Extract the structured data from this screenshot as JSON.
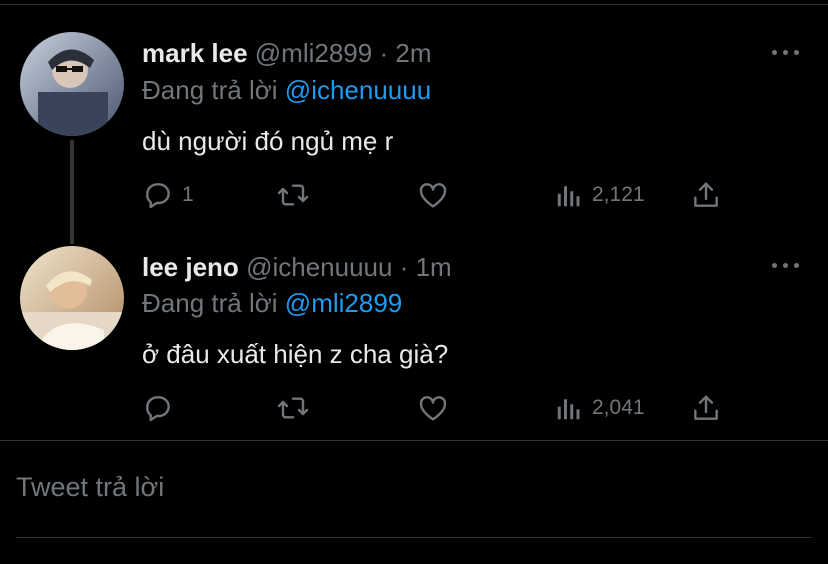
{
  "tweets": [
    {
      "name": "mark lee",
      "handle": "@mli2899",
      "separator": "·",
      "time": "2m",
      "replying_prefix": "Đang trả lời",
      "replying_to": "@ichenuuuu",
      "text": "dù người đó ngủ mẹ r",
      "reply_count": "1",
      "retweet_count": "",
      "like_count": "",
      "views": "2,121",
      "avatar_colors": [
        "#a9b4c8",
        "#5f6c86"
      ]
    },
    {
      "name": "lee jeno",
      "handle": "@ichenuuuu",
      "separator": "·",
      "time": "1m",
      "replying_prefix": "Đang trả lời",
      "replying_to": "@mli2899",
      "text": "ở đâu xuất hiện z cha già?",
      "reply_count": "",
      "retweet_count": "",
      "like_count": "",
      "views": "2,041",
      "avatar_colors": [
        "#e8d5b4",
        "#8a6a48"
      ]
    }
  ],
  "reply_box": {
    "placeholder": "Tweet trả lời"
  },
  "icons": [
    "reply-icon",
    "retweet-icon",
    "like-icon",
    "views-icon",
    "share-icon",
    "more-icon"
  ],
  "colors": {
    "background": "#000000",
    "text": "#e7e9ea",
    "muted": "#71767b",
    "link": "#1d9bf0",
    "divider": "#2f3336"
  }
}
